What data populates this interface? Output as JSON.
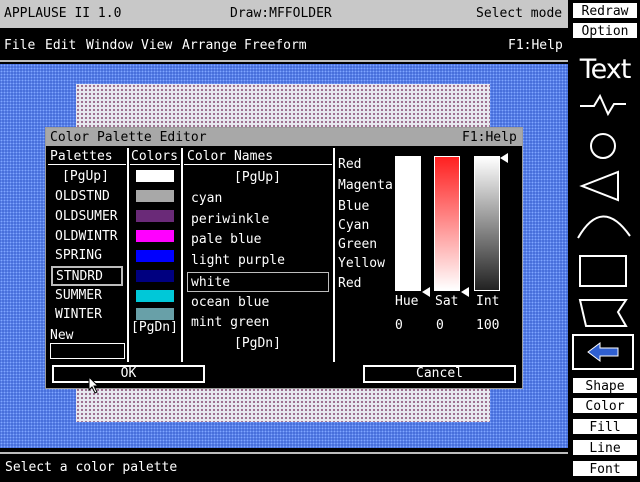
{
  "titlebar": {
    "app": "APPLAUSE II  1.0",
    "document": "Draw:MFFOLDER",
    "mode": "Select mode"
  },
  "menubar": {
    "items": [
      "File",
      "Edit",
      "Window",
      "View",
      "Arrange",
      "Freeform"
    ],
    "help": "F1:Help"
  },
  "statusbar": {
    "text": "Select a color palette"
  },
  "rightpanel": {
    "top_buttons": [
      "Redraw",
      "Option"
    ],
    "text_tool": "Text",
    "tools": [
      "line-tool",
      "circle-tool",
      "triangle-tool",
      "arc-tool",
      "rectangle-tool",
      "flag-shape-tool"
    ],
    "bottom_buttons": [
      "Shape",
      "Color",
      "Fill",
      "Line",
      "Font"
    ]
  },
  "dialog": {
    "title": "Color Palette Editor",
    "help": "F1:Help",
    "palettes_header": "Palettes",
    "palettes": [
      "[PgUp]",
      "OLDSTND",
      "OLDSUMER",
      "OLDWINTR",
      "SPRING",
      "STNDRD",
      "SUMMER",
      "WINTER"
    ],
    "selected_palette": "STNDRD",
    "new_label": "New",
    "colors_header": "Colors",
    "swatches": [
      "#ffffff",
      "#a8a8a8",
      "#6a2a78",
      "#ff00ff",
      "#0000ff",
      "#000080",
      "#00c8d8",
      "#68a0a8"
    ],
    "colors_pgdn": "[PgDn]",
    "names_header": "Color Names",
    "names": [
      "[PgUp]",
      "cyan",
      "periwinkle",
      "pale blue",
      "light purple",
      "white",
      "ocean blue",
      "mint green",
      "[PgDn]"
    ],
    "selected_name": "white",
    "channel_labels": [
      "Red",
      "Magenta",
      "Blue",
      "Cyan",
      "Green",
      "Yellow",
      "Red"
    ],
    "sliders": [
      {
        "label": "Hue",
        "value": "0"
      },
      {
        "label": "Sat",
        "value": "0"
      },
      {
        "label": "Int",
        "value": "100"
      }
    ],
    "ok_label": "OK",
    "cancel_label": "Cancel"
  }
}
